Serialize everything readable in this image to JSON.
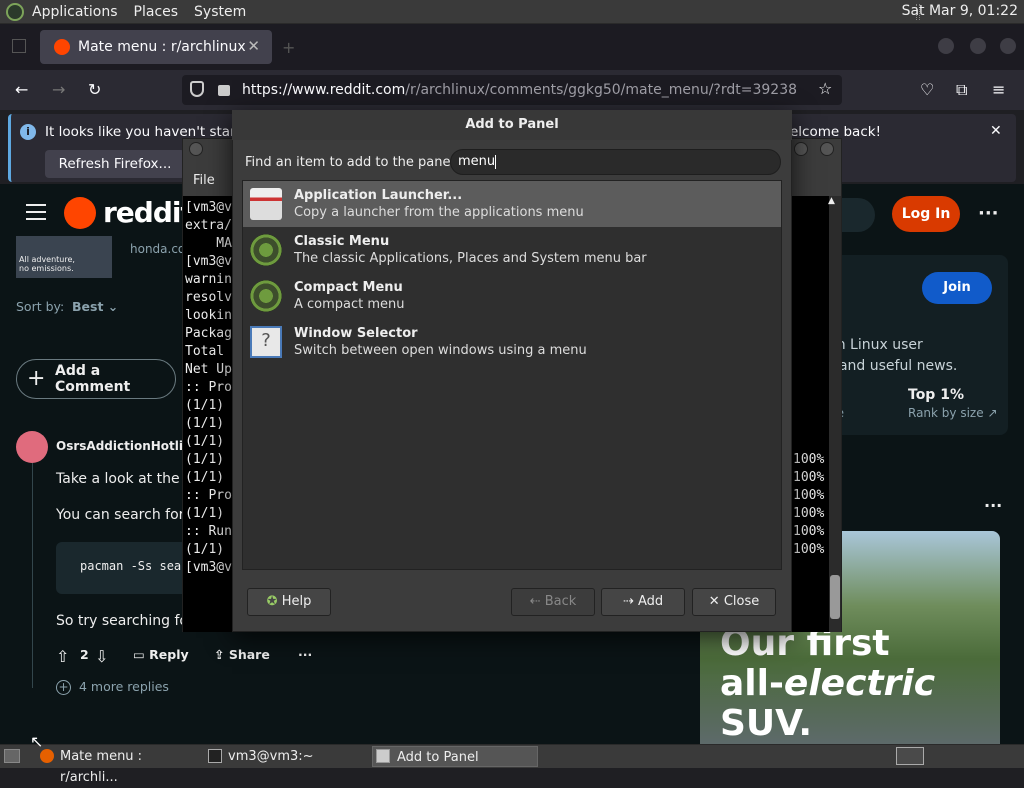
{
  "top_panel": {
    "menus": [
      "Applications",
      "Places",
      "System"
    ],
    "clock": "Sat Mar  9, 01:22"
  },
  "browser": {
    "tab_title": "Mate menu : r/archlinux",
    "url_main": "https://www.reddit.com",
    "url_rest": "/r/archlinux/comments/ggkg50/mate_menu/?rdt=39238",
    "notification": {
      "text": "It looks like you haven't started",
      "button": "Refresh Firefox...",
      "welcome": "elcome back!"
    }
  },
  "reddit": {
    "logo_text": "reddit",
    "login": "Log In",
    "ad_site": "honda.com",
    "ad_lines": [
      "All adventure,",
      "no emissions."
    ],
    "sort_label": "Sort by:",
    "sort_value": "Best",
    "add_comment": "Add a Comment",
    "comment": {
      "user": "OsrsAddictionHotline",
      "line1_pre": "Take a look at the ",
      "line1_link": "ar",
      "line2": "You can search for p",
      "code": "pacman -Ss sea",
      "line3": "So try searching for",
      "votes": "2",
      "reply": "Reply",
      "share": "Share",
      "more": "···"
    },
    "more_replies": "4 more replies",
    "sidebar": {
      "join": "Join",
      "desc1": "ch Linux user",
      "desc2": "t and useful news.",
      "online": "ne",
      "top": "Top 1%",
      "rank": "Rank by size"
    },
    "ad": {
      "line1": "Our first",
      "line2a": "all-",
      "line2b": "electric",
      "line2c": " SUV."
    }
  },
  "terminal": {
    "menu_file": "File",
    "lines": [
      "[vm3@v",
      "extra/",
      "    MA",
      "[vm3@v",
      "warnin",
      "resolv",
      "lookin",
      "",
      "Packag",
      "",
      "Total ",
      "Net Up",
      "",
      ":: Pro",
      "(1/1) ",
      "(1/1) ",
      "(1/1) ",
      "(1/1) ",
      "(1/1) ",
      ":: Pro",
      "(1/1) ",
      ":: Run",
      "(1/1) ",
      "[vm3@v"
    ],
    "percents": [
      "100%",
      "100%",
      "100%",
      "100%",
      "100%",
      "",
      "100%"
    ]
  },
  "dialog": {
    "title": "Add to Panel",
    "find_label": "Find an item to add to the panel:",
    "search_value": "menu",
    "items": [
      {
        "title": "Application Launcher...",
        "desc": "Copy a launcher from the applications menu",
        "icon": "launcher-icon"
      },
      {
        "title": "Classic Menu",
        "desc": "The classic Applications, Places and System menu bar",
        "icon": "mate-menu-icon"
      },
      {
        "title": "Compact Menu",
        "desc": "A compact menu",
        "icon": "mate-menu-icon"
      },
      {
        "title": "Window Selector",
        "desc": "Switch between open windows using a menu",
        "icon": "window-selector-icon"
      }
    ],
    "buttons": {
      "help": "Help",
      "back": "Back",
      "add": "Add",
      "close": "Close"
    }
  },
  "taskbar": {
    "tasks": [
      "Mate menu : r/archli...",
      "vm3@vm3:~",
      "Add to Panel"
    ]
  }
}
